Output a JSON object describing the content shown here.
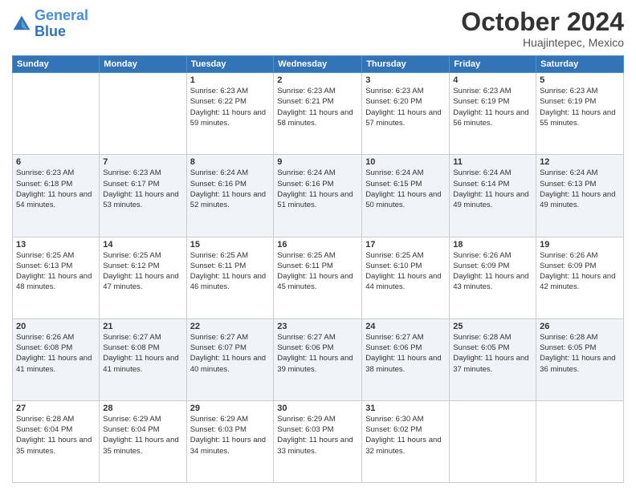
{
  "header": {
    "logo_line1": "General",
    "logo_line2": "Blue",
    "month": "October 2024",
    "location": "Huajintepec, Mexico"
  },
  "weekdays": [
    "Sunday",
    "Monday",
    "Tuesday",
    "Wednesday",
    "Thursday",
    "Friday",
    "Saturday"
  ],
  "weeks": [
    [
      {
        "day": "",
        "sunrise": "",
        "sunset": "",
        "daylight": ""
      },
      {
        "day": "",
        "sunrise": "",
        "sunset": "",
        "daylight": ""
      },
      {
        "day": "1",
        "sunrise": "Sunrise: 6:23 AM",
        "sunset": "Sunset: 6:22 PM",
        "daylight": "Daylight: 11 hours and 59 minutes."
      },
      {
        "day": "2",
        "sunrise": "Sunrise: 6:23 AM",
        "sunset": "Sunset: 6:21 PM",
        "daylight": "Daylight: 11 hours and 58 minutes."
      },
      {
        "day": "3",
        "sunrise": "Sunrise: 6:23 AM",
        "sunset": "Sunset: 6:20 PM",
        "daylight": "Daylight: 11 hours and 57 minutes."
      },
      {
        "day": "4",
        "sunrise": "Sunrise: 6:23 AM",
        "sunset": "Sunset: 6:19 PM",
        "daylight": "Daylight: 11 hours and 56 minutes."
      },
      {
        "day": "5",
        "sunrise": "Sunrise: 6:23 AM",
        "sunset": "Sunset: 6:19 PM",
        "daylight": "Daylight: 11 hours and 55 minutes."
      }
    ],
    [
      {
        "day": "6",
        "sunrise": "Sunrise: 6:23 AM",
        "sunset": "Sunset: 6:18 PM",
        "daylight": "Daylight: 11 hours and 54 minutes."
      },
      {
        "day": "7",
        "sunrise": "Sunrise: 6:23 AM",
        "sunset": "Sunset: 6:17 PM",
        "daylight": "Daylight: 11 hours and 53 minutes."
      },
      {
        "day": "8",
        "sunrise": "Sunrise: 6:24 AM",
        "sunset": "Sunset: 6:16 PM",
        "daylight": "Daylight: 11 hours and 52 minutes."
      },
      {
        "day": "9",
        "sunrise": "Sunrise: 6:24 AM",
        "sunset": "Sunset: 6:16 PM",
        "daylight": "Daylight: 11 hours and 51 minutes."
      },
      {
        "day": "10",
        "sunrise": "Sunrise: 6:24 AM",
        "sunset": "Sunset: 6:15 PM",
        "daylight": "Daylight: 11 hours and 50 minutes."
      },
      {
        "day": "11",
        "sunrise": "Sunrise: 6:24 AM",
        "sunset": "Sunset: 6:14 PM",
        "daylight": "Daylight: 11 hours and 49 minutes."
      },
      {
        "day": "12",
        "sunrise": "Sunrise: 6:24 AM",
        "sunset": "Sunset: 6:13 PM",
        "daylight": "Daylight: 11 hours and 49 minutes."
      }
    ],
    [
      {
        "day": "13",
        "sunrise": "Sunrise: 6:25 AM",
        "sunset": "Sunset: 6:13 PM",
        "daylight": "Daylight: 11 hours and 48 minutes."
      },
      {
        "day": "14",
        "sunrise": "Sunrise: 6:25 AM",
        "sunset": "Sunset: 6:12 PM",
        "daylight": "Daylight: 11 hours and 47 minutes."
      },
      {
        "day": "15",
        "sunrise": "Sunrise: 6:25 AM",
        "sunset": "Sunset: 6:11 PM",
        "daylight": "Daylight: 11 hours and 46 minutes."
      },
      {
        "day": "16",
        "sunrise": "Sunrise: 6:25 AM",
        "sunset": "Sunset: 6:11 PM",
        "daylight": "Daylight: 11 hours and 45 minutes."
      },
      {
        "day": "17",
        "sunrise": "Sunrise: 6:25 AM",
        "sunset": "Sunset: 6:10 PM",
        "daylight": "Daylight: 11 hours and 44 minutes."
      },
      {
        "day": "18",
        "sunrise": "Sunrise: 6:26 AM",
        "sunset": "Sunset: 6:09 PM",
        "daylight": "Daylight: 11 hours and 43 minutes."
      },
      {
        "day": "19",
        "sunrise": "Sunrise: 6:26 AM",
        "sunset": "Sunset: 6:09 PM",
        "daylight": "Daylight: 11 hours and 42 minutes."
      }
    ],
    [
      {
        "day": "20",
        "sunrise": "Sunrise: 6:26 AM",
        "sunset": "Sunset: 6:08 PM",
        "daylight": "Daylight: 11 hours and 41 minutes."
      },
      {
        "day": "21",
        "sunrise": "Sunrise: 6:27 AM",
        "sunset": "Sunset: 6:08 PM",
        "daylight": "Daylight: 11 hours and 41 minutes."
      },
      {
        "day": "22",
        "sunrise": "Sunrise: 6:27 AM",
        "sunset": "Sunset: 6:07 PM",
        "daylight": "Daylight: 11 hours and 40 minutes."
      },
      {
        "day": "23",
        "sunrise": "Sunrise: 6:27 AM",
        "sunset": "Sunset: 6:06 PM",
        "daylight": "Daylight: 11 hours and 39 minutes."
      },
      {
        "day": "24",
        "sunrise": "Sunrise: 6:27 AM",
        "sunset": "Sunset: 6:06 PM",
        "daylight": "Daylight: 11 hours and 38 minutes."
      },
      {
        "day": "25",
        "sunrise": "Sunrise: 6:28 AM",
        "sunset": "Sunset: 6:05 PM",
        "daylight": "Daylight: 11 hours and 37 minutes."
      },
      {
        "day": "26",
        "sunrise": "Sunrise: 6:28 AM",
        "sunset": "Sunset: 6:05 PM",
        "daylight": "Daylight: 11 hours and 36 minutes."
      }
    ],
    [
      {
        "day": "27",
        "sunrise": "Sunrise: 6:28 AM",
        "sunset": "Sunset: 6:04 PM",
        "daylight": "Daylight: 11 hours and 35 minutes."
      },
      {
        "day": "28",
        "sunrise": "Sunrise: 6:29 AM",
        "sunset": "Sunset: 6:04 PM",
        "daylight": "Daylight: 11 hours and 35 minutes."
      },
      {
        "day": "29",
        "sunrise": "Sunrise: 6:29 AM",
        "sunset": "Sunset: 6:03 PM",
        "daylight": "Daylight: 11 hours and 34 minutes."
      },
      {
        "day": "30",
        "sunrise": "Sunrise: 6:29 AM",
        "sunset": "Sunset: 6:03 PM",
        "daylight": "Daylight: 11 hours and 33 minutes."
      },
      {
        "day": "31",
        "sunrise": "Sunrise: 6:30 AM",
        "sunset": "Sunset: 6:02 PM",
        "daylight": "Daylight: 11 hours and 32 minutes."
      },
      {
        "day": "",
        "sunrise": "",
        "sunset": "",
        "daylight": ""
      },
      {
        "day": "",
        "sunrise": "",
        "sunset": "",
        "daylight": ""
      }
    ]
  ]
}
